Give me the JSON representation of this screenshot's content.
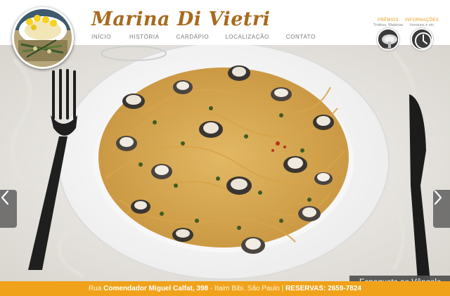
{
  "brand": {
    "name": "Marina Di Vietri"
  },
  "nav": [
    {
      "label": "INÍCIO"
    },
    {
      "label": "HISTÓRIA"
    },
    {
      "label": "CARDÁPIO"
    },
    {
      "label": "LOCALIZAÇÃO"
    },
    {
      "label": "CONTATO"
    }
  ],
  "quick_links": {
    "awards": {
      "title": "PRÊMIOS",
      "subtitle": "Troféus, Matérias",
      "icon": "award-plates-icon"
    },
    "info": {
      "title": "INFORMAÇÕES",
      "subtitle": "Horários e etc",
      "icon": "clock-icon"
    }
  },
  "slider": {
    "caption": "Espaguete ao Vôngole",
    "prev_icon": "chevron-left-icon",
    "next_icon": "chevron-right-icon"
  },
  "footer": {
    "prefix": "Rua",
    "street": "Comendador Miguel Calfat, 398",
    "district": "- Itaim Bibi. São Paulo |",
    "reservas_label": "RESERVAS:",
    "phone": "2659-7824"
  },
  "colors": {
    "accent": "#f0a21a",
    "brand_text": "#a86a1e",
    "nav_text": "#7a7a7a"
  }
}
